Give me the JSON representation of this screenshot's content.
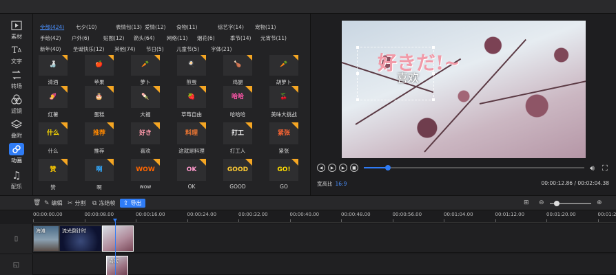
{
  "sidebar": {
    "items": [
      {
        "label": "素材",
        "icon": "folder-play-icon"
      },
      {
        "label": "文字",
        "icon": "text-icon"
      },
      {
        "label": "转场",
        "icon": "transition-icon"
      },
      {
        "label": "滤镜",
        "icon": "filter-icon"
      },
      {
        "label": "叠附",
        "icon": "layers-icon"
      },
      {
        "label": "动画",
        "icon": "link-icon"
      },
      {
        "label": "配乐",
        "icon": "music-note-icon"
      }
    ],
    "active": "动画"
  },
  "categories": [
    {
      "label": "全部(424)",
      "active": true
    },
    {
      "label": "七夕(10)"
    },
    {
      "label": "表情包(13)"
    },
    {
      "label": "爱情(12)"
    },
    {
      "label": "食物(11)"
    },
    {
      "label": "综艺字(14)"
    },
    {
      "label": "宠物(11)"
    },
    {
      "label": "手绘(42)"
    },
    {
      "label": "户外(6)"
    },
    {
      "label": "贴图(12)"
    },
    {
      "label": "箭头(64)"
    },
    {
      "label": "网络(11)"
    },
    {
      "label": "烟花(6)"
    },
    {
      "label": "季节(14)"
    },
    {
      "label": "元宵节(11)"
    },
    {
      "label": "新年(40)"
    },
    {
      "label": "圣诞快乐(12)"
    },
    {
      "label": "其他(74)"
    },
    {
      "label": "节日(5)"
    },
    {
      "label": "儿童节(5)"
    },
    {
      "label": "字体(21)"
    }
  ],
  "stickers": [
    {
      "name": "清酒",
      "art": "🍶"
    },
    {
      "name": "苹果",
      "art": "🍎"
    },
    {
      "name": "萝卜",
      "art": "🥕"
    },
    {
      "name": "煎蛋",
      "art": "🍳"
    },
    {
      "name": "鸡腿",
      "art": "🍗"
    },
    {
      "name": "胡萝卜",
      "art": "🥕"
    },
    {
      "name": "红薯",
      "art": "🍠"
    },
    {
      "name": "蛋糕",
      "art": "🎂"
    },
    {
      "name": "大福",
      "art": "🍡"
    },
    {
      "name": "草莓自由",
      "art": "🍓"
    },
    {
      "name": "哈哈哈",
      "art": "哈哈"
    },
    {
      "name": "美味大挑战",
      "art": "🍒"
    },
    {
      "name": "什么",
      "art": "什么"
    },
    {
      "name": "推荐",
      "art": "推荐"
    },
    {
      "name": "喜欢",
      "art": "好き"
    },
    {
      "name": "这就是料理",
      "art": "料理"
    },
    {
      "name": "打工人",
      "art": "打工"
    },
    {
      "name": "紧张",
      "art": "紧张"
    },
    {
      "name": "赞",
      "art": "赞"
    },
    {
      "name": "啊",
      "art": "啊"
    },
    {
      "name": "wow",
      "art": "WOW"
    },
    {
      "name": "OK",
      "art": "OK"
    },
    {
      "name": "GOOD",
      "art": "GOOD"
    },
    {
      "name": "GO",
      "art": "GO!"
    }
  ],
  "preview": {
    "overlay_jp": "好きだ!~",
    "overlay_cn": "喜欢",
    "aspect_label": "宽高比",
    "aspect_value": "16:9",
    "time_current": "00:00:12.86",
    "time_total": "00:02:04.38",
    "progress": 0.11
  },
  "toolbar": {
    "edit": "编辑",
    "split": "分割",
    "freeze": "冻结帧",
    "export": "导出"
  },
  "timeline": {
    "ticks": [
      "00:00:00.00",
      "00:00:08.00",
      "00:00:16.00",
      "00:00:24.00",
      "00:00:32.00",
      "00:00:40.00",
      "00:00:48.00",
      "00:00:56.00",
      "00:01:04.00",
      "00:01:12.00",
      "00:01:20.00",
      "00:01:28.00"
    ],
    "clips": [
      {
        "title": "海滩"
      },
      {
        "title": "流光倒计时"
      },
      {
        "title": ""
      }
    ],
    "overlay_clip": {
      "title": "喜欢"
    }
  },
  "colors": {
    "accent": "#2f7cf6",
    "badge": "#f5a623",
    "overlay_pink": "#f19aa8"
  }
}
